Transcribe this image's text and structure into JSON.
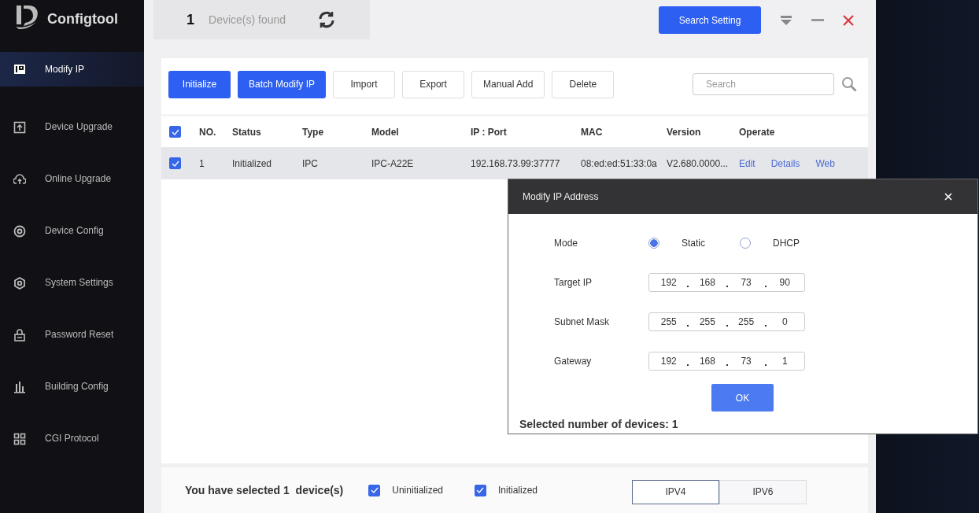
{
  "app": {
    "name": "Configtool"
  },
  "sidebar": {
    "items": [
      {
        "label": "Modify IP",
        "selected": true
      },
      {
        "label": "Device Upgrade",
        "selected": false
      },
      {
        "label": "Online Upgrade",
        "selected": false
      },
      {
        "label": "Device Config",
        "selected": false
      },
      {
        "label": "System Settings",
        "selected": false
      },
      {
        "label": "Password Reset",
        "selected": false
      },
      {
        "label": "Building Config",
        "selected": false
      },
      {
        "label": "CGI Protocol",
        "selected": false
      }
    ]
  },
  "header": {
    "count": "1",
    "count_label": "Device(s) found",
    "search_setting": "Search Setting"
  },
  "toolbar": {
    "buttons": [
      {
        "label": "Initialize",
        "kind": "primary"
      },
      {
        "label": "Batch Modify IP",
        "kind": "primary"
      },
      {
        "label": "Import",
        "kind": "plain"
      },
      {
        "label": "Export",
        "kind": "plain"
      },
      {
        "label": "Manual Add",
        "kind": "plain"
      },
      {
        "label": "Delete",
        "kind": "plain"
      }
    ],
    "search": {
      "placeholder": "Search"
    }
  },
  "table": {
    "all_checked": true,
    "columns": [
      "NO.",
      "Status",
      "Type",
      "Model",
      "IP : Port",
      "MAC",
      "Version",
      "Operate"
    ],
    "rows": [
      {
        "checked": true,
        "cells": [
          "1",
          "Initialized",
          "IPC",
          "IPC-A22E",
          "192.168.73.99:37777",
          "08:ed:ed:51:33:0a",
          "V2.680.0000..."
        ],
        "links": [
          "Edit",
          "Details",
          "Web"
        ]
      }
    ]
  },
  "footer": {
    "selected_text": "You have selected 1  device(s)",
    "filters": [
      {
        "label": "Uninitialized",
        "checked": true
      },
      {
        "label": "Initialized",
        "checked": true
      }
    ],
    "tabs": [
      {
        "label": "IPV4",
        "selected": true
      },
      {
        "label": "IPV6",
        "selected": false
      }
    ]
  },
  "dialog": {
    "title": "Modify IP Address",
    "mode_label": "Mode",
    "modes": [
      {
        "label": "Static",
        "selected": true
      },
      {
        "label": "DHCP",
        "selected": false
      }
    ],
    "fields": [
      {
        "label": "Target IP",
        "octets": [
          "192",
          "168",
          "73",
          "90"
        ]
      },
      {
        "label": "Subnet Mask",
        "octets": [
          "255",
          "255",
          "255",
          "0"
        ]
      },
      {
        "label": "Gateway",
        "octets": [
          "192",
          "168",
          "73",
          "1"
        ]
      }
    ],
    "ok": "OK",
    "summary": "Selected number of devices: 1"
  }
}
